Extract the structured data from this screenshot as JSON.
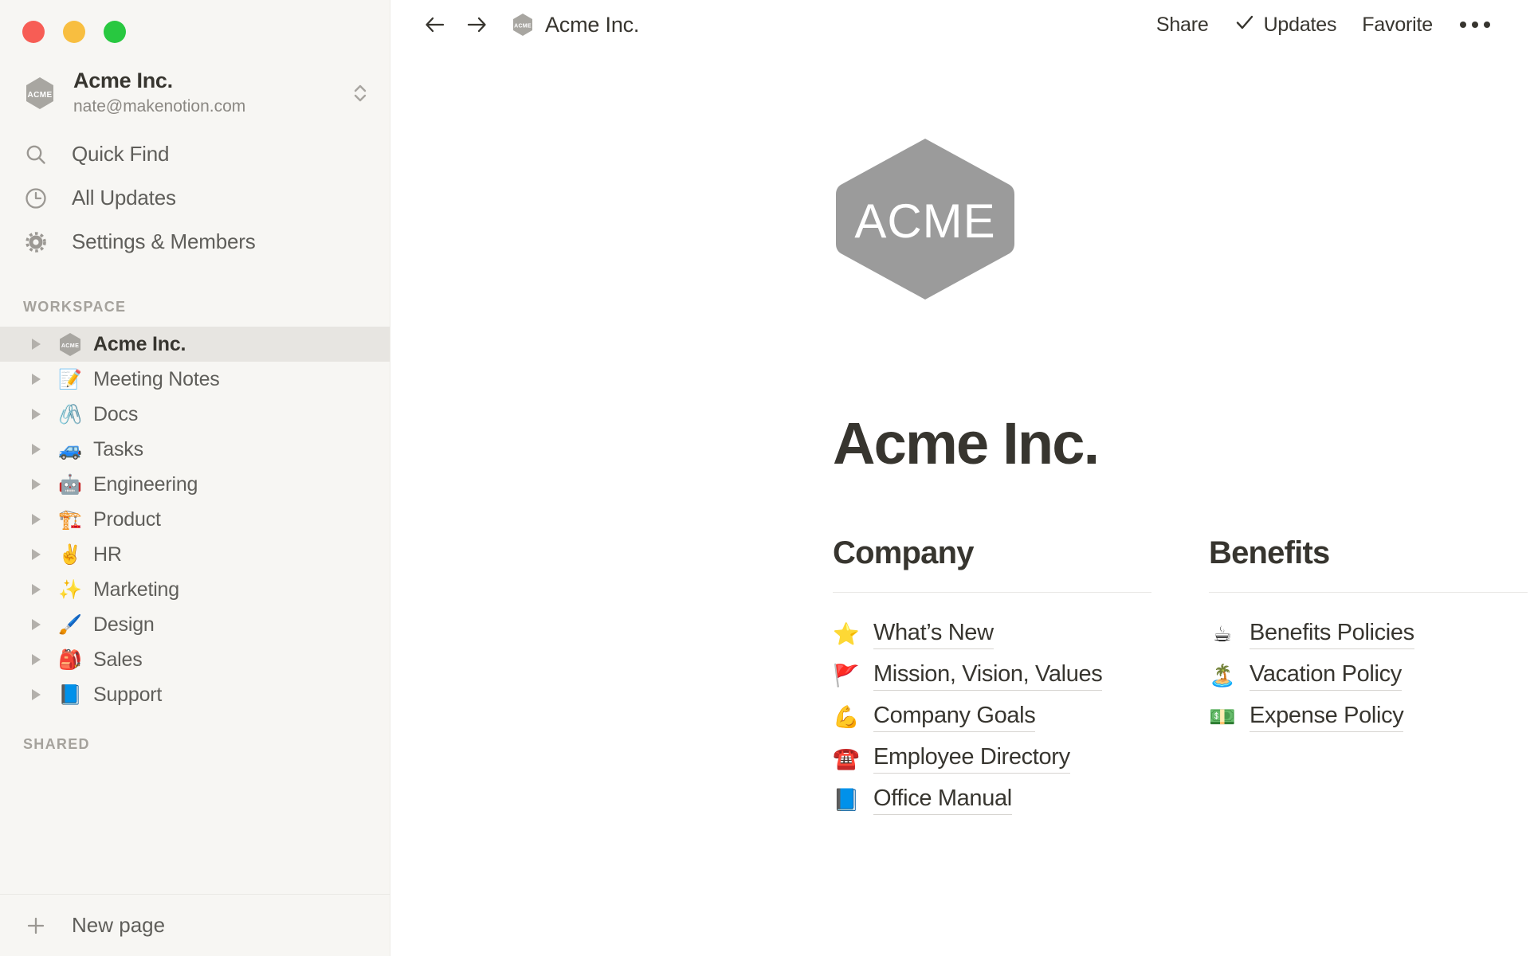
{
  "window": {
    "traffic_lights": [
      {
        "name": "close",
        "color": "#f75d55"
      },
      {
        "name": "minimize",
        "color": "#f8be40"
      },
      {
        "name": "maximize",
        "color": "#28c840"
      }
    ]
  },
  "sidebar": {
    "workspace_switcher": {
      "icon": "acme-hexagon-badge",
      "badge_text": "ACME",
      "title": "Acme Inc.",
      "email": "nate@makenotion.com",
      "chevron_icon": "chevron-up-down-icon"
    },
    "nav": [
      {
        "icon": "search-icon",
        "label": "Quick Find"
      },
      {
        "icon": "clock-icon",
        "label": "All Updates"
      },
      {
        "icon": "gear-icon",
        "label": "Settings & Members"
      }
    ],
    "workspace_section_label": "WORKSPACE",
    "pages": [
      {
        "emoji": "ACME",
        "label": "Acme Inc.",
        "active": true,
        "is_badge": true
      },
      {
        "emoji": "📝",
        "label": "Meeting Notes",
        "active": false
      },
      {
        "emoji": "🖇️",
        "label": "Docs",
        "active": false
      },
      {
        "emoji": "🚙",
        "label": "Tasks",
        "active": false
      },
      {
        "emoji": "🤖",
        "label": "Engineering",
        "active": false
      },
      {
        "emoji": "🏗️",
        "label": "Product",
        "active": false
      },
      {
        "emoji": "✌️",
        "label": "HR",
        "active": false
      },
      {
        "emoji": "✨",
        "label": "Marketing",
        "active": false
      },
      {
        "emoji": "🖌️",
        "label": "Design",
        "active": false
      },
      {
        "emoji": "🎒",
        "label": "Sales",
        "active": false
      },
      {
        "emoji": "📘",
        "label": "Support",
        "active": false
      }
    ],
    "shared_section_label": "SHARED",
    "footer": {
      "icon": "plus-icon",
      "label": "New page"
    }
  },
  "topbar": {
    "back_icon": "arrow-left-icon",
    "forward_icon": "arrow-right-icon",
    "breadcrumb_badge": "ACME",
    "breadcrumb_title": "Acme Inc.",
    "share_label": "Share",
    "updates_label": "Updates",
    "updates_icon": "check-icon",
    "favorite_label": "Favorite",
    "more_icon": "ellipsis-icon"
  },
  "page": {
    "hero_logo": {
      "icon": "acme-hexagon-logo",
      "text": "ACME",
      "color": "#9b9b9b"
    },
    "title": "Acme Inc.",
    "columns": [
      {
        "heading": "Company",
        "links": [
          {
            "emoji": "⭐",
            "label": "What’s New"
          },
          {
            "emoji": "🚩",
            "label": "Mission, Vision, Values"
          },
          {
            "emoji": "💪",
            "label": "Company Goals"
          },
          {
            "emoji": "☎️",
            "label": "Employee Directory"
          },
          {
            "emoji": "📘",
            "label": "Office Manual"
          }
        ]
      },
      {
        "heading": "Benefits",
        "links": [
          {
            "emoji": "☕",
            "label": "Benefits Policies"
          },
          {
            "emoji": "🏝️",
            "label": "Vacation Policy"
          },
          {
            "emoji": "💵",
            "label": "Expense Policy"
          }
        ]
      }
    ]
  },
  "colors": {
    "sidebar_bg": "#f7f6f3",
    "main_bg": "#ffffff",
    "text_primary": "#37352f",
    "text_secondary": "#5f5e5a",
    "text_muted": "#a5a29c",
    "active_row_bg": "#e7e5e1",
    "logo_gray": "#9b9b9b"
  }
}
